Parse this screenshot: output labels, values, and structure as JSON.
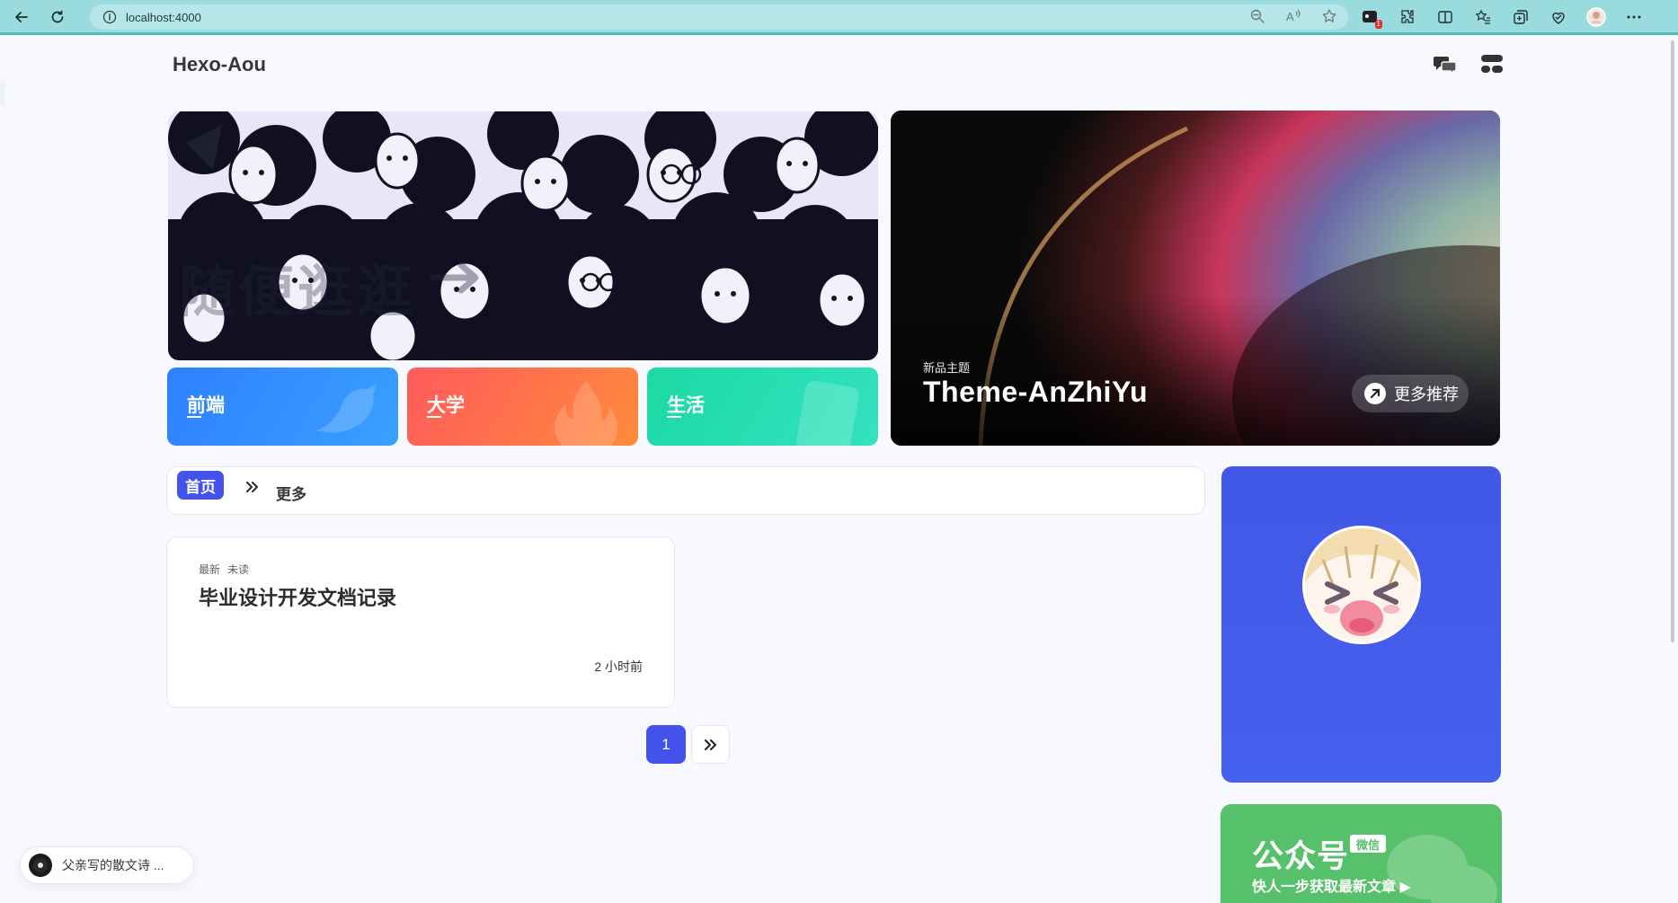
{
  "browser": {
    "url": "localhost:4000",
    "notification_count": "1"
  },
  "site": {
    "title": "Hexo-Aou"
  },
  "banner": {
    "watermark_text": "随便逛逛"
  },
  "categories": [
    {
      "label": "前端",
      "icon": "bird-icon"
    },
    {
      "label": "大学",
      "icon": "flame-icon"
    },
    {
      "label": "生活",
      "icon": "note-icon"
    }
  ],
  "hero": {
    "kicker": "新品主题",
    "title": "Theme-AnZhiYu",
    "more_label": "更多推荐"
  },
  "nav": {
    "home_label": "首页",
    "more_label": "更多"
  },
  "posts": [
    {
      "tags": [
        "最新",
        "未读"
      ],
      "title": "毕业设计开发文档记录",
      "time": "2 小时前"
    }
  ],
  "pagination": {
    "current": "1"
  },
  "wechat": {
    "title": "公众号",
    "badge": "微信",
    "subtitle": "快人一步获取最新文章 ▶"
  },
  "music": {
    "title": "父亲写的散文诗 ..."
  },
  "colors": {
    "accent": "#4252ea",
    "browser_bar": "#9adcde",
    "wechat_green": "#57c06a"
  }
}
